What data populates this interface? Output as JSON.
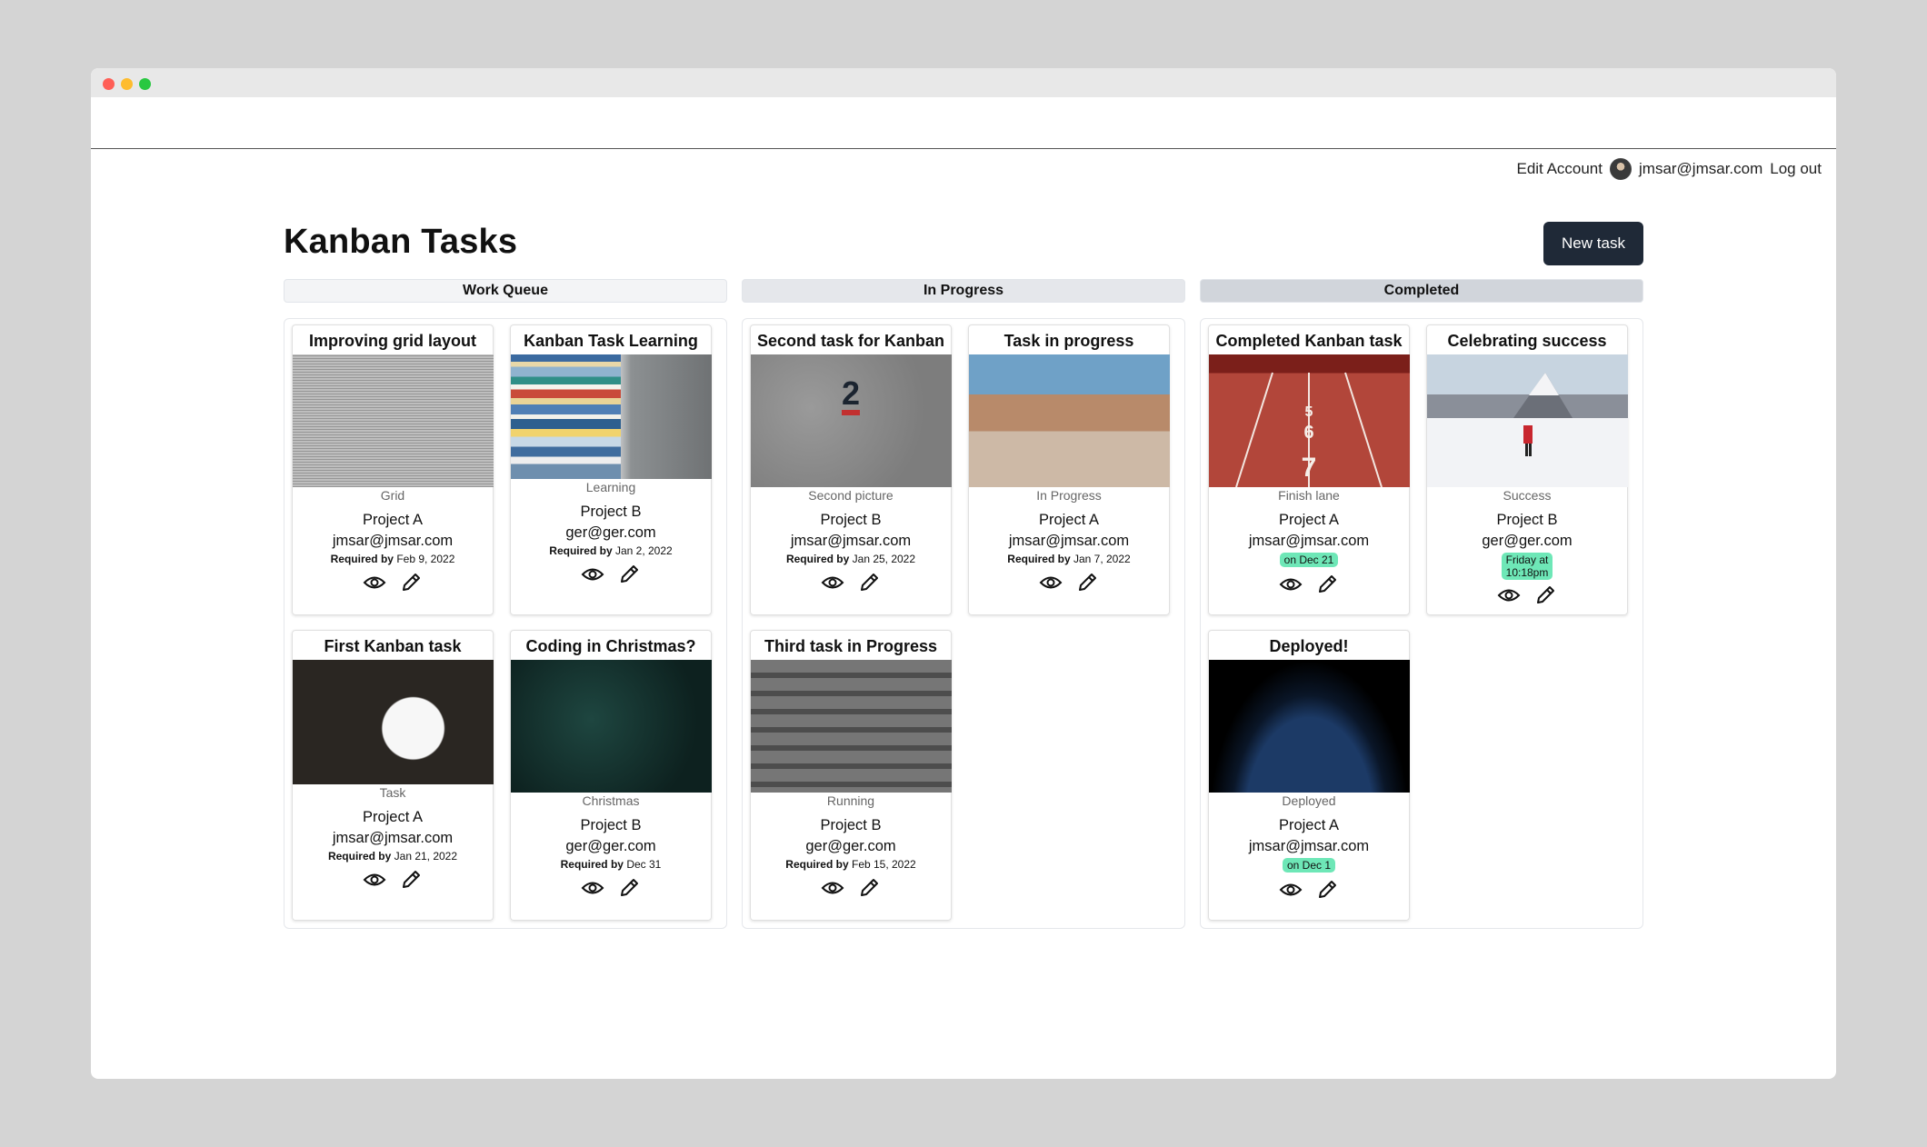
{
  "nav": {
    "edit_account": "Edit Account",
    "user_email": "jmsar@jmsar.com",
    "logout": "Log out"
  },
  "page": {
    "title": "Kanban Tasks",
    "new_task": "New task"
  },
  "columns": [
    {
      "name": "Work Queue",
      "header_bg": "#f3f4f6",
      "cards": [
        {
          "title": "Improving grid layout",
          "caption": "Grid",
          "project": "Project A",
          "email": "jmsar@jmsar.com",
          "due_label": "Required by",
          "due_date": "Feb 9, 2022"
        },
        {
          "title": "Kanban Task Learning",
          "caption": "Learning",
          "project": "Project B",
          "email": "ger@ger.com",
          "due_label": "Required by",
          "due_date": "Jan 2, 2022"
        },
        {
          "title": "First Kanban task",
          "caption": "Task",
          "project": "Project A",
          "email": "jmsar@jmsar.com",
          "due_label": "Required by",
          "due_date": "Jan 21, 2022"
        },
        {
          "title": "Coding in Christmas?",
          "caption": "Christmas",
          "project": "Project B",
          "email": "ger@ger.com",
          "due_label": "Required by",
          "due_date": "Dec 31"
        }
      ]
    },
    {
      "name": "In Progress",
      "header_bg": "#e5e7eb",
      "cards": [
        {
          "title": "Second task for Kanban",
          "caption": "Second picture",
          "project": "Project B",
          "email": "jmsar@jmsar.com",
          "due_label": "Required by",
          "due_date": "Jan 25, 2022"
        },
        {
          "title": "Task in progress",
          "caption": "In Progress",
          "project": "Project A",
          "email": "jmsar@jmsar.com",
          "due_label": "Required by",
          "due_date": "Jan 7, 2022"
        },
        {
          "title": "Third task in Progress",
          "caption": "Running",
          "project": "Project B",
          "email": "ger@ger.com",
          "due_label": "Required by",
          "due_date": "Feb 15, 2022"
        }
      ]
    },
    {
      "name": "Completed",
      "header_bg": "#d1d5db",
      "cards": [
        {
          "title": "Completed Kanban task",
          "caption": "Finish lane",
          "project": "Project A",
          "email": "jmsar@jmsar.com",
          "badge": "on Dec 21"
        },
        {
          "title": "Celebrating success",
          "caption": "Success",
          "project": "Project B",
          "email": "ger@ger.com",
          "badge_line1": "Friday at",
          "badge_line2": "10:18pm"
        },
        {
          "title": "Deployed!",
          "caption": "Deployed",
          "project": "Project A",
          "email": "jmsar@jmsar.com",
          "badge": "on Dec 1"
        }
      ]
    }
  ],
  "icons": {
    "view": "eye-icon",
    "edit": "pencil-icon"
  },
  "colors": {
    "button_bg": "#1f2937",
    "badge_bg": "#6ee7b7"
  }
}
